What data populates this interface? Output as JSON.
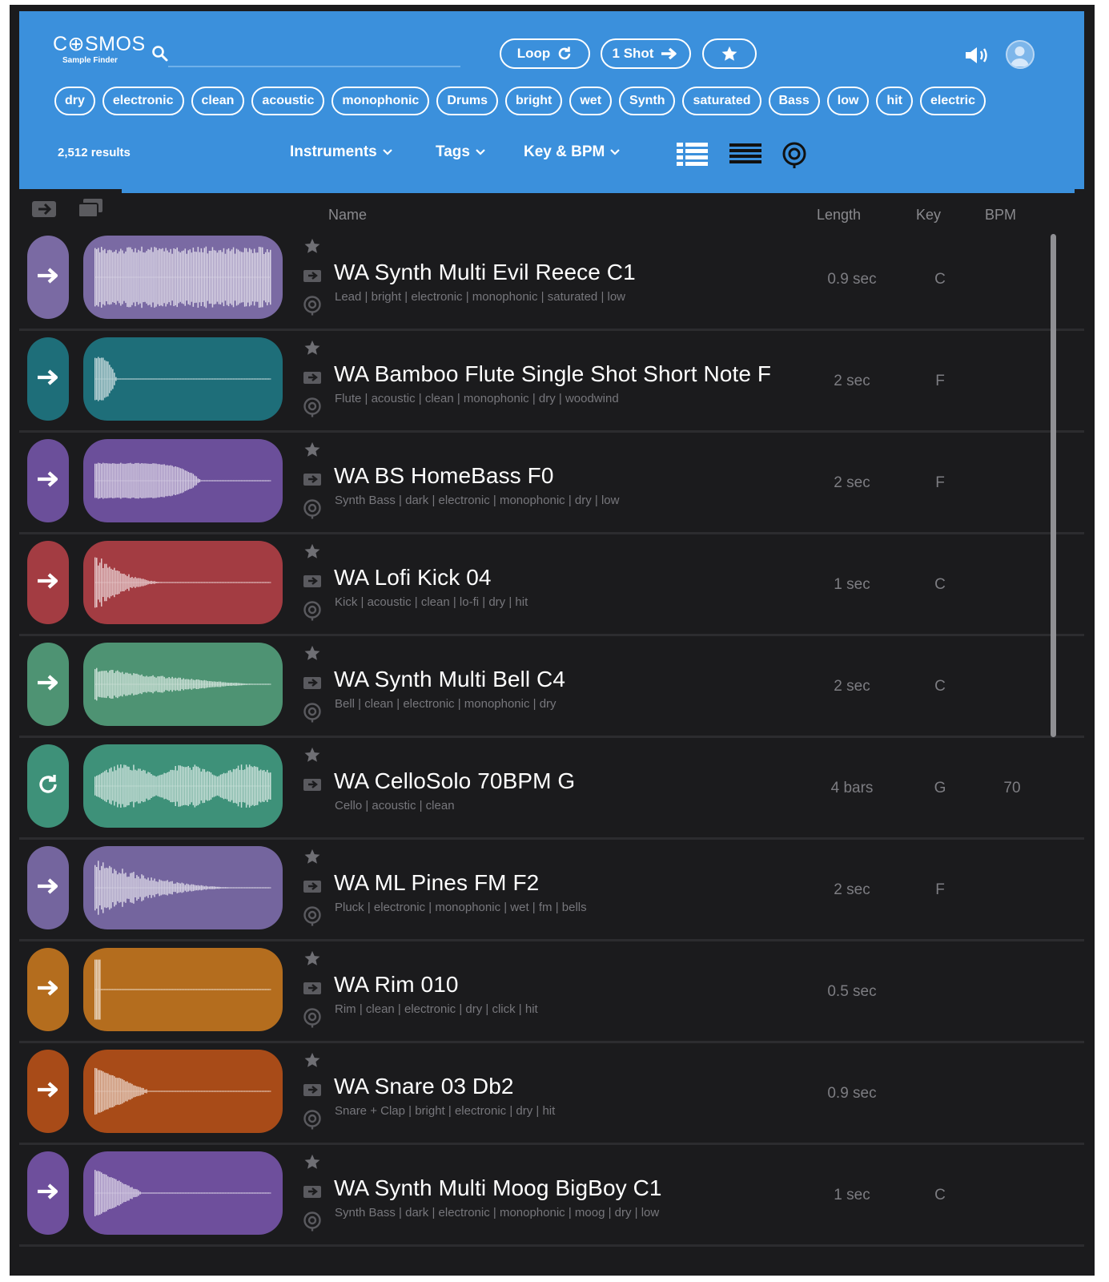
{
  "app": {
    "logo": "C⊕SMOS",
    "logo_subtitle": "Sample Finder"
  },
  "header": {
    "modes": {
      "loop": "Loop",
      "one_shot": "1 Shot"
    },
    "tags": [
      "dry",
      "electronic",
      "clean",
      "acoustic",
      "monophonic",
      "Drums",
      "bright",
      "wet",
      "Synth",
      "saturated",
      "Bass",
      "low",
      "hit",
      "electric"
    ],
    "results": "2,512 results",
    "filters": {
      "instruments": "Instruments",
      "tags": "Tags",
      "key_bpm": "Key & BPM"
    }
  },
  "columns": {
    "name": "Name",
    "length": "Length",
    "key": "Key",
    "bpm": "BPM"
  },
  "colors": {
    "header_blue": "#3b90dc",
    "background": "#1b1b1d"
  },
  "samples": [
    {
      "title": "WA Synth Multi Evil Reece C1",
      "tags": "Lead | bright | electronic | monophonic | saturated | low",
      "length": "0.9 sec",
      "key": "C",
      "bpm": "",
      "mode": "one-shot",
      "color": "#7a6aa3",
      "wave": "dense",
      "fill": 1.0
    },
    {
      "title": "WA Bamboo Flute Single Shot Short Note F",
      "tags": "Flute | acoustic | clean | monophonic | dry | woodwind",
      "length": "2 sec",
      "key": "F",
      "bpm": "",
      "mode": "one-shot",
      "color": "#1e6e79",
      "wave": "short",
      "fill": 0.12
    },
    {
      "title": "WA BS HomeBass F0",
      "tags": "Synth Bass | dark | electronic | monophonic | dry | low",
      "length": "2 sec",
      "key": "F",
      "bpm": "",
      "mode": "one-shot",
      "color": "#6b4f9a",
      "wave": "block",
      "fill": 0.6
    },
    {
      "title": "WA Lofi Kick 04",
      "tags": "Kick | acoustic | clean | lo-fi | dry | hit",
      "length": "1 sec",
      "key": "C",
      "bpm": "",
      "mode": "one-shot",
      "color": "#a33c42",
      "wave": "decay",
      "fill": 0.45
    },
    {
      "title": "WA Synth Multi Bell C4",
      "tags": "Bell | clean | electronic | monophonic | dry",
      "length": "2 sec",
      "key": "C",
      "bpm": "",
      "mode": "one-shot",
      "color": "#4e9373",
      "wave": "longdecay",
      "fill": 0.95
    },
    {
      "title": "WA CelloSolo 70BPM G",
      "tags": "Cello | acoustic | clean",
      "length": "4 bars",
      "key": "G",
      "bpm": "70",
      "mode": "loop",
      "color": "#3e9179",
      "wave": "loop",
      "fill": 1.0
    },
    {
      "title": "WA ML Pines FM F2",
      "tags": "Pluck | electronic | monophonic | wet | fm | bells",
      "length": "2 sec",
      "key": "F",
      "bpm": "",
      "mode": "one-shot",
      "color": "#74659e",
      "wave": "decay",
      "fill": 0.9
    },
    {
      "title": "WA Rim 010",
      "tags": "Rim | clean | electronic | dry | click | hit",
      "length": "0.5 sec",
      "key": "",
      "bpm": "",
      "mode": "one-shot",
      "color": "#b46d1e",
      "wave": "spike",
      "fill": 0.03
    },
    {
      "title": "WA Snare 03 Db2",
      "tags": "Snare + Clap | bright | electronic | dry | hit",
      "length": "0.9 sec",
      "key": "",
      "bpm": "",
      "mode": "one-shot",
      "color": "#a84b18",
      "wave": "triangle",
      "fill": 0.3
    },
    {
      "title": "WA Synth Multi Moog BigBoy C1",
      "tags": "Synth Bass | dark | electronic | monophonic | moog | dry | low",
      "length": "1 sec",
      "key": "C",
      "bpm": "",
      "mode": "one-shot",
      "color": "#6e4f9c",
      "wave": "triangle",
      "fill": 0.27
    }
  ]
}
